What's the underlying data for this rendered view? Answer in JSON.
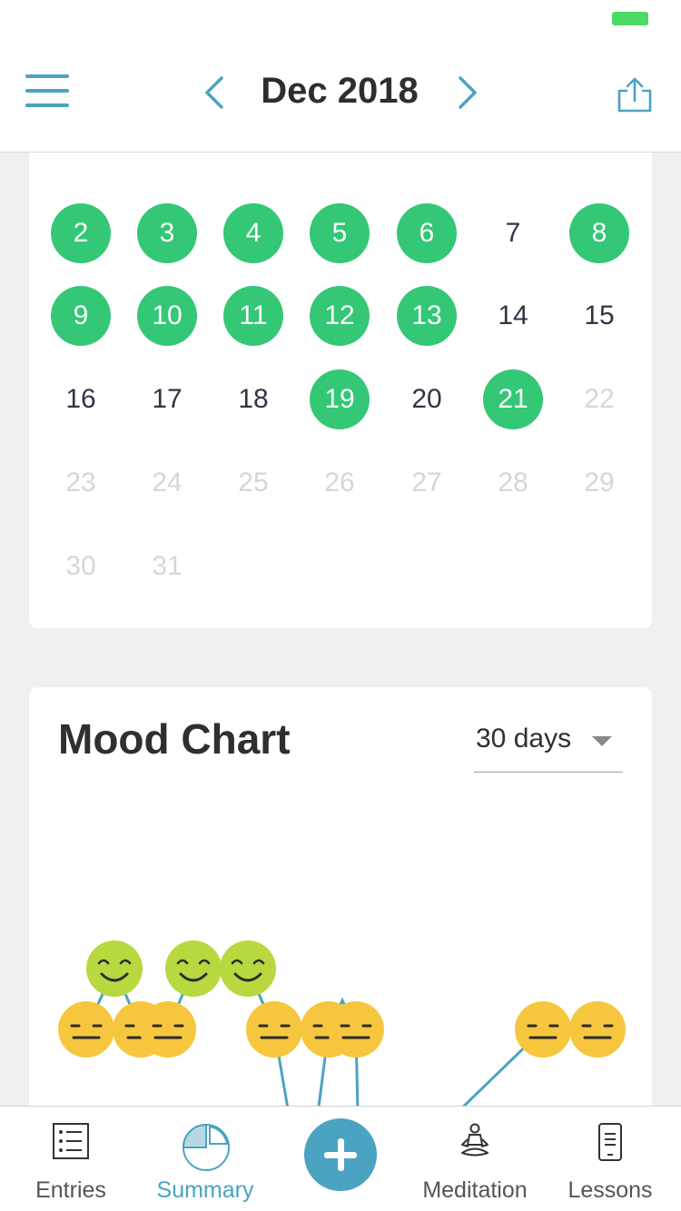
{
  "header": {
    "month_title": "Dec 2018",
    "menu_icon": "hamburger-menu-icon",
    "prev_icon": "chevron-left-icon",
    "next_icon": "chevron-right-icon",
    "share_icon": "share-icon",
    "accent_color": "#4aa3c1"
  },
  "calendar": {
    "logged_color": "#33c776",
    "weeks": [
      [
        {
          "day": "2",
          "state": "logged"
        },
        {
          "day": "3",
          "state": "logged"
        },
        {
          "day": "4",
          "state": "logged"
        },
        {
          "day": "5",
          "state": "logged"
        },
        {
          "day": "6",
          "state": "logged"
        },
        {
          "day": "7",
          "state": "empty"
        },
        {
          "day": "8",
          "state": "logged"
        }
      ],
      [
        {
          "day": "9",
          "state": "logged"
        },
        {
          "day": "10",
          "state": "logged"
        },
        {
          "day": "11",
          "state": "logged"
        },
        {
          "day": "12",
          "state": "logged"
        },
        {
          "day": "13",
          "state": "logged"
        },
        {
          "day": "14",
          "state": "empty"
        },
        {
          "day": "15",
          "state": "empty"
        }
      ],
      [
        {
          "day": "16",
          "state": "empty"
        },
        {
          "day": "17",
          "state": "empty"
        },
        {
          "day": "18",
          "state": "empty"
        },
        {
          "day": "19",
          "state": "logged"
        },
        {
          "day": "20",
          "state": "empty"
        },
        {
          "day": "21",
          "state": "logged"
        },
        {
          "day": "22",
          "state": "future"
        }
      ],
      [
        {
          "day": "23",
          "state": "future"
        },
        {
          "day": "24",
          "state": "future"
        },
        {
          "day": "25",
          "state": "future"
        },
        {
          "day": "26",
          "state": "future"
        },
        {
          "day": "27",
          "state": "future"
        },
        {
          "day": "28",
          "state": "future"
        },
        {
          "day": "29",
          "state": "future"
        }
      ],
      [
        {
          "day": "30",
          "state": "future"
        },
        {
          "day": "31",
          "state": "future"
        }
      ]
    ]
  },
  "mood_chart": {
    "title": "Mood Chart",
    "range_label": "30 days",
    "range_caret_icon": "caret-down-icon",
    "line_color": "#4aa3c1",
    "moods": [
      {
        "mood": "neutral",
        "icon": "neutral-face-icon",
        "color": "#f6c63e"
      },
      {
        "mood": "good",
        "icon": "smiling-face-icon",
        "color": "#b7d83f"
      }
    ]
  },
  "tab_bar": {
    "tabs": [
      {
        "label": "Entries",
        "icon": "list-icon",
        "active": false
      },
      {
        "label": "Summary",
        "icon": "pie-chart-icon",
        "active": true
      },
      {
        "label": "Meditation",
        "icon": "meditation-icon",
        "active": false
      },
      {
        "label": "Lessons",
        "icon": "phone-lessons-icon",
        "active": false
      }
    ],
    "add_icon": "plus-icon"
  }
}
